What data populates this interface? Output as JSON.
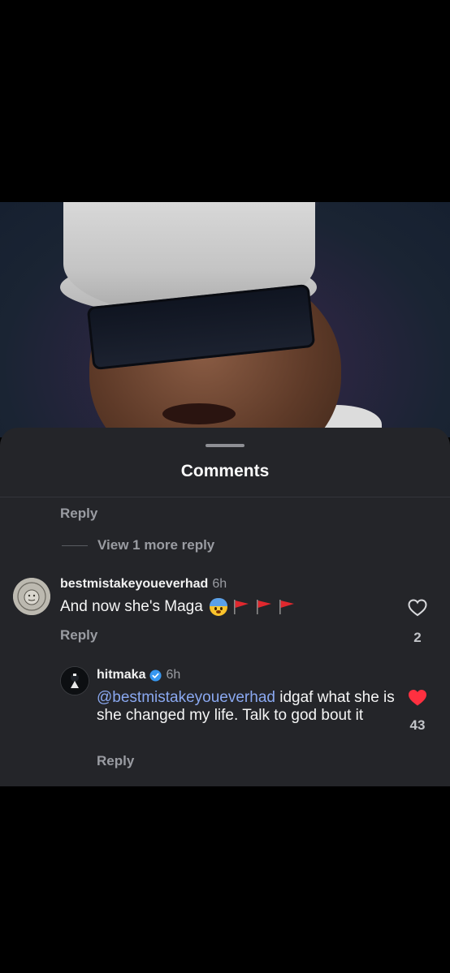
{
  "sheet": {
    "title": "Comments"
  },
  "thread": {
    "reply_label": "Reply",
    "view_more_label": "View 1 more reply"
  },
  "comments": [
    {
      "username": "bestmistakeyoueverhad",
      "time": "6h",
      "text": "And now she's Maga",
      "emojis": [
        "fearful-face",
        "red-flag",
        "red-flag",
        "red-flag"
      ],
      "reply_label": "Reply",
      "likes": "2",
      "liked": false
    },
    {
      "username": "hitmaka",
      "verified": true,
      "time": "6h",
      "mention": "@bestmistakeyoueverhad",
      "text": " idgaf what she is she changed my life. Talk to god bout it",
      "reply_label": "Reply",
      "likes": "43",
      "liked": true
    }
  ],
  "colors": {
    "sheet_bg": "#242529",
    "mention": "#8aa8f0",
    "like_active": "#ff3040",
    "verified": "#3797f0"
  }
}
